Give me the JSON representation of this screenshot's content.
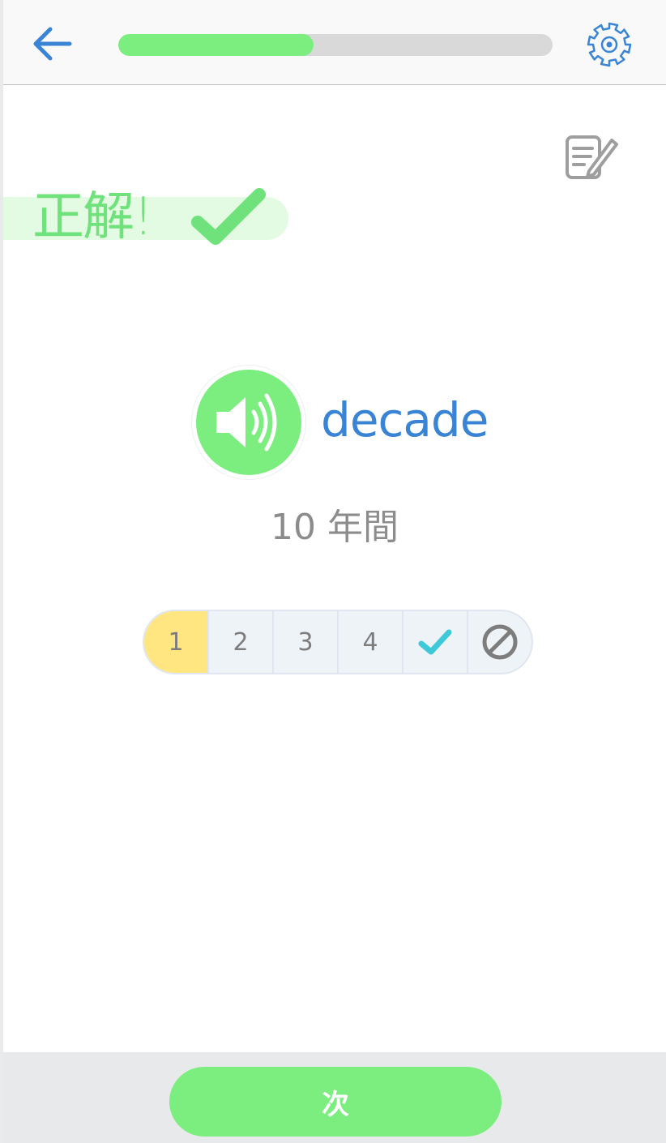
{
  "header": {
    "progress_fraction": 0.45,
    "progress_color": "#7bee7f",
    "accent_color": "#3a84d6"
  },
  "feedback": {
    "label": "正解!",
    "color": "#6fe27b"
  },
  "card": {
    "word": "decade",
    "meaning": "10 年間"
  },
  "rating": {
    "options": [
      "1",
      "2",
      "3",
      "4"
    ],
    "selected_index": 0,
    "selected_color": "#ffe680",
    "done_icon": "check-icon",
    "skip_icon": "prohibited-icon"
  },
  "footer": {
    "next_label": "次"
  }
}
